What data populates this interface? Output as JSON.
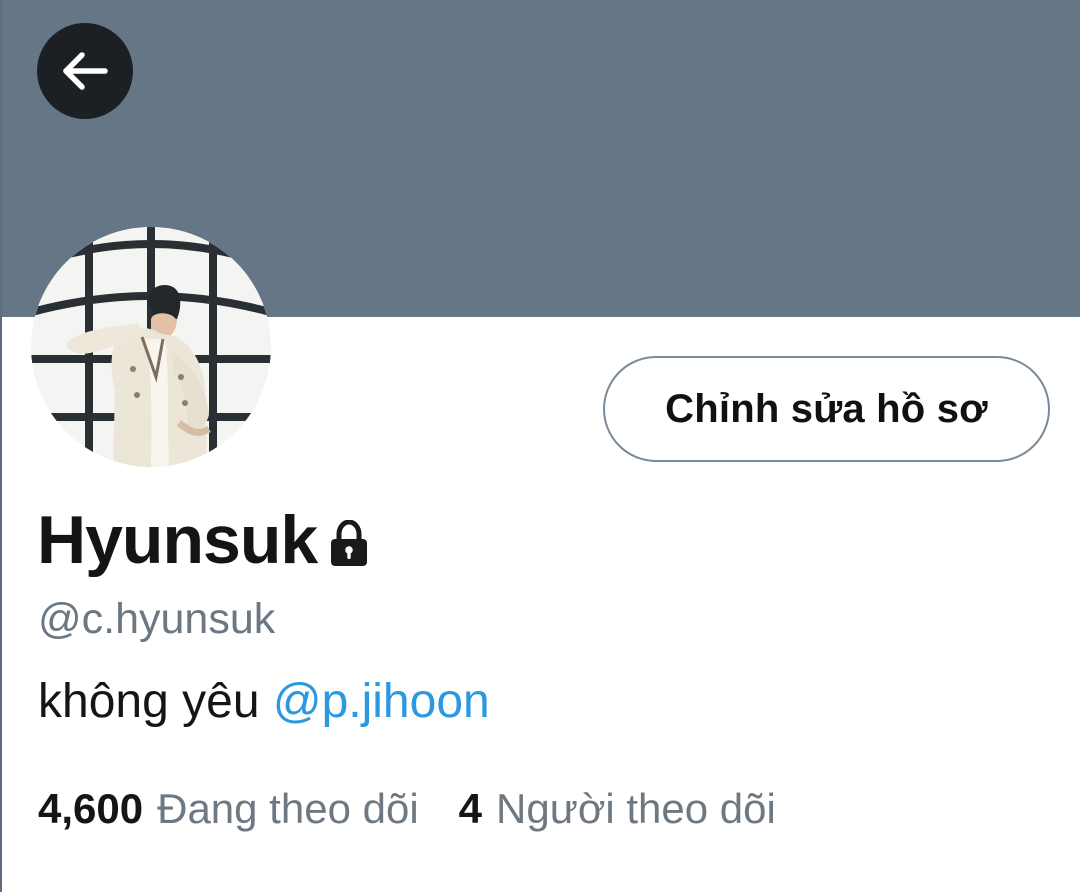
{
  "profile": {
    "display_name": "Hyunsuk",
    "handle": "@c.hyunsuk",
    "bio_text": "không yêu ",
    "bio_mention": "@p.jihoon",
    "edit_profile_label": "Chỉnh sửa hồ sơ",
    "is_protected": true
  },
  "stats": {
    "following_count": "4,600",
    "following_label": "Đang theo dõi",
    "followers_count": "4",
    "followers_label": "Người theo dõi"
  },
  "colors": {
    "banner": "#657686",
    "back_button": "#1c2024",
    "link": "#2c98df",
    "muted_text": "#6b7884",
    "primary_text": "#141414"
  },
  "icons": {
    "back": "arrow-left-icon",
    "lock": "lock-icon"
  }
}
